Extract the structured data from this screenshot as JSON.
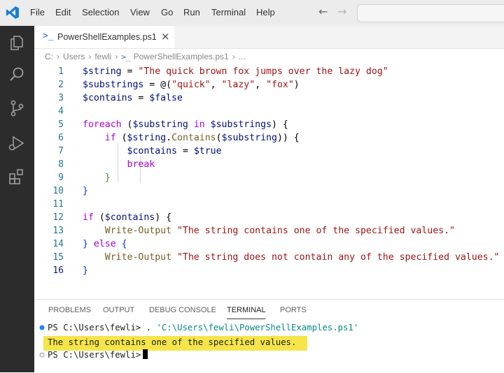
{
  "menu": [
    "File",
    "Edit",
    "Selection",
    "View",
    "Go",
    "Run",
    "Terminal",
    "Help"
  ],
  "tab": {
    "icon": "powershell-icon",
    "label": "PowerShellExamples.ps1",
    "close": "×"
  },
  "breadcrumb": [
    "C:",
    "Users",
    "fewli",
    "PowerShellExamples.ps1",
    "..."
  ],
  "code": {
    "line_numbers": [
      "1",
      "2",
      "3",
      "4",
      "5",
      "6",
      "7",
      "8",
      "9",
      "10",
      "11",
      "12",
      "13",
      "14",
      "15",
      "16"
    ],
    "l1": {
      "var": "$string",
      "op": " = ",
      "str": "\"The quick brown fox jumps over the lazy dog\""
    },
    "l2": {
      "var": "$substrings",
      "op": " = ",
      "at": "@(",
      "s1": "\"quick\"",
      "c1": ", ",
      "s2": "\"lazy\"",
      "c2": ", ",
      "s3": "\"fox\"",
      "close": ")"
    },
    "l3": {
      "var": "$contains",
      "op": " = ",
      "val": "$false"
    },
    "l5": {
      "kw": "foreach",
      "p1": " (",
      "v1": "$substring",
      "kw2": " in ",
      "v2": "$substrings",
      "p2": ") {"
    },
    "l6": {
      "kw": "if",
      "p1": " (",
      "v1": "$string",
      "dot": ".",
      "fn": "Contains",
      "p2": "(",
      "v2": "$substring",
      "p3": ")) {"
    },
    "l7": {
      "var": "$contains",
      "op": " = ",
      "val": "$true"
    },
    "l8": {
      "kw": "break"
    },
    "l9": {
      "brace": "}"
    },
    "l10": {
      "brace": "}"
    },
    "l12": {
      "kw": "if",
      "p1": " (",
      "v1": "$contains",
      "p2": ") {"
    },
    "l13": {
      "cmd": "Write-Output",
      "str": " \"The string contains one of the specified values.\""
    },
    "l14": {
      "b1": "}",
      "kw": " else",
      "b2": " {"
    },
    "l15": {
      "cmd": "Write-Output",
      "str": " \"The string does not contain any of the specified values.\""
    },
    "l16": {
      "brace": "}"
    }
  },
  "panel": {
    "tabs": [
      "PROBLEMS",
      "OUTPUT",
      "DEBUG CONSOLE",
      "TERMINAL",
      "PORTS"
    ],
    "active_tab": "TERMINAL",
    "terminal": {
      "prompt1": "PS C:\\Users\\fewli> ",
      "cmd_dot": ". ",
      "cmd_path": "'C:\\Users\\fewli\\PowerShellExamples.ps1'",
      "output": "The string contains one of the specified values.",
      "prompt2": "PS C:\\Users\\fewli>"
    }
  },
  "colors": {
    "keyword": "#af00db",
    "variable": "#001080",
    "string": "#a31515",
    "function": "#795e26",
    "command": "#795e26",
    "highlight": "#f5e54a"
  }
}
